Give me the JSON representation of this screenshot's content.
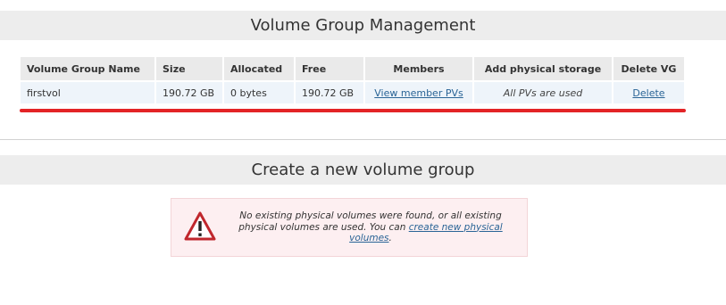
{
  "vg_section": {
    "title": "Volume Group Management",
    "columns": [
      "Volume Group Name",
      "Size",
      "Allocated",
      "Free",
      "Members",
      "Add physical storage",
      "Delete VG"
    ],
    "row": {
      "name": "firstvol",
      "size": "190.72 GB",
      "allocated": "0 bytes",
      "free": "190.72 GB",
      "members_link": "View member PVs",
      "add_storage": "All PVs are used",
      "delete_link": "Delete"
    },
    "highlight_color": "#e32326"
  },
  "create_section": {
    "title": "Create a new volume group",
    "warning": {
      "text_before": "No existing physical volumes were found, or all existing physical volumes are used. You can ",
      "link": "create new physical volumes",
      "text_after": ".",
      "icon": "warning-triangle-icon"
    }
  }
}
